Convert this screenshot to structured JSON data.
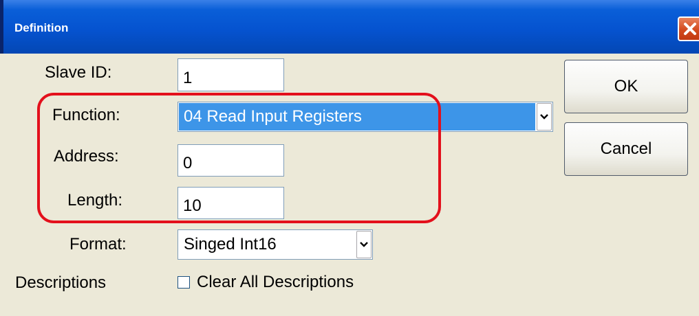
{
  "window": {
    "title": "Definition"
  },
  "form": {
    "slave_id_label": "Slave ID:",
    "slave_id_value": "1",
    "function_label": "Function:",
    "function_value": "04 Read Input Registers",
    "address_label": "Address:",
    "address_value": "0",
    "length_label": "Length:",
    "length_value": "10",
    "format_label": "Format:",
    "format_value": "Singed Int16",
    "descriptions_label": "Descriptions",
    "clear_descriptions_label": "Clear All Descriptions",
    "clear_descriptions_checked": false
  },
  "buttons": {
    "ok": "OK",
    "cancel": "Cancel"
  },
  "icons": {
    "close": "close-icon",
    "dropdown": "chevron-down-icon"
  },
  "colors": {
    "titlebar": "#0553d0",
    "selection": "#3d95e8",
    "highlight_outline": "#e3101c",
    "dialog_background": "#ece9d8"
  }
}
